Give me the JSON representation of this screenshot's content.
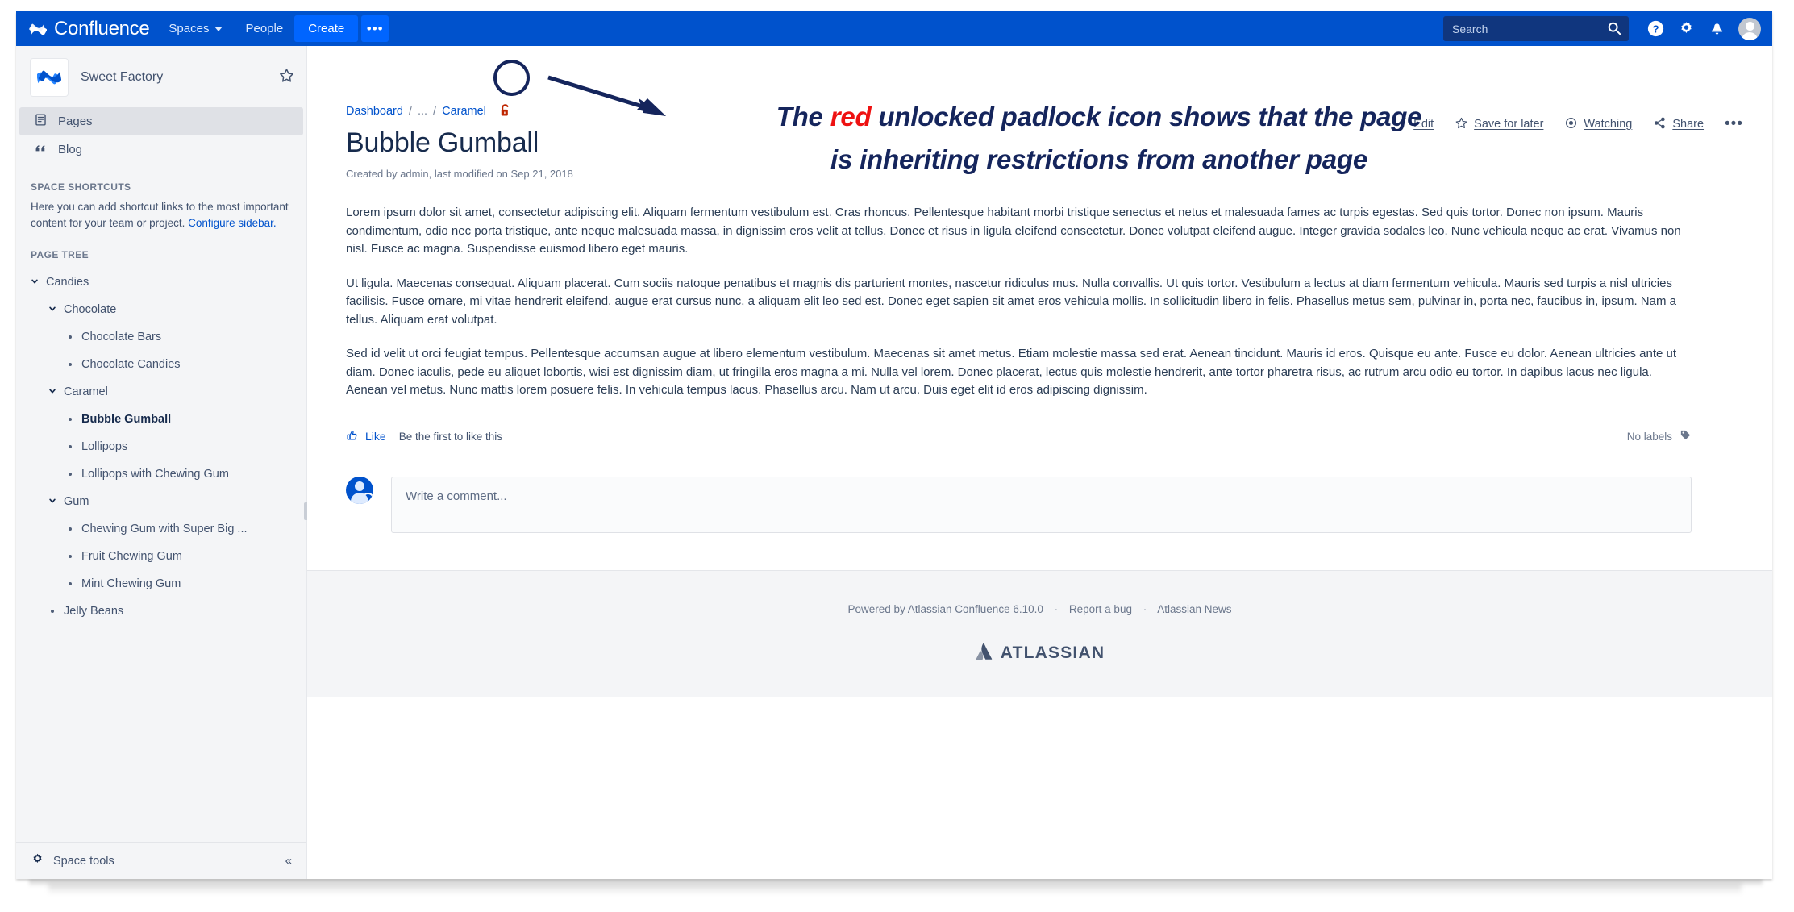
{
  "topnav": {
    "brand": "Confluence",
    "brand_logo_icon": "confluence-logo-icon",
    "items": [
      {
        "label": "Spaces",
        "icon": "chevron-down-icon"
      },
      {
        "label": "People",
        "icon": ""
      }
    ],
    "create_label": "Create",
    "more_label": "•••",
    "search": {
      "placeholder": "Search",
      "value": "",
      "icon": "search-icon"
    },
    "icons": [
      "help-icon",
      "gear-icon",
      "notification-bell-icon",
      "user-avatar-icon"
    ]
  },
  "sidebar": {
    "space_name": "Sweet Factory",
    "space_logo_icon": "confluence-space-logo-icon",
    "star_icon": "star-outline-icon",
    "links": [
      {
        "label": "Pages",
        "icon": "pages-icon",
        "active": true
      },
      {
        "label": "Blog",
        "icon": "quote-icon",
        "active": false
      }
    ],
    "shortcuts_heading": "SPACE SHORTCUTS",
    "shortcuts_description": "Here you can add shortcut links to the most important content for your team or project.",
    "configure_link": "Configure sidebar.",
    "pagetree_heading": "PAGE TREE",
    "tree": [
      {
        "label": "Candies",
        "level": 0,
        "marker": "chevron",
        "selected": false
      },
      {
        "label": "Chocolate",
        "level": 1,
        "marker": "chevron",
        "selected": false
      },
      {
        "label": "Chocolate Bars",
        "level": 2,
        "marker": "dot",
        "selected": false
      },
      {
        "label": "Chocolate Candies",
        "level": 2,
        "marker": "dot",
        "selected": false
      },
      {
        "label": "Caramel",
        "level": 1,
        "marker": "chevron",
        "selected": false
      },
      {
        "label": "Bubble Gumball",
        "level": 2,
        "marker": "dot",
        "selected": true
      },
      {
        "label": "Lollipops",
        "level": 2,
        "marker": "dot",
        "selected": false
      },
      {
        "label": "Lollipops with Chewing Gum",
        "level": 2,
        "marker": "dot",
        "selected": false
      },
      {
        "label": "Gum",
        "level": 1,
        "marker": "chevron",
        "selected": false
      },
      {
        "label": "Chewing Gum with Super Big ...",
        "level": 2,
        "marker": "dot",
        "selected": false
      },
      {
        "label": "Fruit Chewing Gum",
        "level": 2,
        "marker": "dot",
        "selected": false
      },
      {
        "label": "Mint Chewing Gum",
        "level": 2,
        "marker": "dot",
        "selected": false
      },
      {
        "label": "Jelly Beans",
        "level": 1,
        "marker": "dot",
        "selected": false
      }
    ],
    "space_tools_label": "Space tools",
    "space_tools_icon": "gear-icon",
    "collapse_icon": "double-chevron-left-icon"
  },
  "page": {
    "breadcrumb": [
      {
        "label": "Dashboard",
        "link": true
      },
      {
        "label": "...",
        "link": false
      },
      {
        "label": "Caramel",
        "link": true
      }
    ],
    "breadcrumb_separator": "/",
    "restriction_icon": "unlocked-padlock-red-icon",
    "title": "Bubble Gumball",
    "meta": "Created by admin, last modified on Sep 21, 2018",
    "actions": [
      {
        "label": "Edit",
        "icon": "pencil-icon"
      },
      {
        "label": "Save for later",
        "icon": "star-outline-icon"
      },
      {
        "label": "Watching",
        "icon": "eye-icon"
      },
      {
        "label": "Share",
        "icon": "share-icon"
      }
    ],
    "actions_more": "•••",
    "paragraphs": [
      "Lorem ipsum dolor sit amet, consectetur adipiscing elit. Aliquam fermentum vestibulum est. Cras rhoncus. Pellentesque habitant morbi tristique senectus et netus et malesuada fames ac turpis egestas. Sed quis tortor. Donec non ipsum. Mauris condimentum, odio nec porta tristique, ante neque malesuada massa, in dignissim eros velit at tellus. Donec et risus in ligula eleifend consectetur. Donec volutpat eleifend augue. Integer gravida sodales leo. Nunc vehicula neque ac erat. Vivamus non nisl. Fusce ac magna. Suspendisse euismod libero eget mauris.",
      "Ut ligula. Maecenas consequat. Aliquam placerat. Cum sociis natoque penatibus et magnis dis parturient montes, nascetur ridiculus mus. Nulla convallis. Ut quis tortor. Vestibulum a lectus at diam fermentum vehicula. Mauris sed turpis a nisl ultricies facilisis. Fusce ornare, mi vitae hendrerit eleifend, augue erat cursus nunc, a aliquam elit leo sed est. Donec eget sapien sit amet eros vehicula mollis. In sollicitudin libero in felis. Phasellus metus sem, pulvinar in, porta nec, faucibus in, ipsum. Nam a tellus. Aliquam erat volutpat.",
      "Sed id velit ut orci feugiat tempus. Pellentesque accumsan augue at libero elementum vestibulum. Maecenas sit amet metus. Etiam molestie massa sed erat. Aenean tincidunt. Mauris id eros. Quisque eu ante. Fusce eu dolor. Aenean ultricies ante ut diam. Donec iaculis, pede eu aliquet lobortis, wisi est dignissim diam, ut fringilla eros magna a mi. Nulla vel lorem. Donec placerat, lectus quis molestie hendrerit, ante tortor pharetra risus, ac rutrum arcu odio eu tortor. In dapibus lacus nec ligula. Aenean vel metus. Nunc mattis lorem posuere felis. In vehicula tempus lacus. Phasellus arcu. Nam ut arcu. Duis eget elit id eros adipiscing dignissim."
    ],
    "like_label": "Like",
    "like_icon": "thumbs-up-icon",
    "like_hint": "Be the first to like this",
    "labels_text": "No labels",
    "labels_icon": "label-tag-icon",
    "comment_placeholder": "Write a comment...",
    "comment_avatar_icon": "user-avatar-edit-icon"
  },
  "footer": {
    "powered_by": "Powered by Atlassian Confluence 6.10.0",
    "report_bug": "Report a bug",
    "news": "Atlassian News",
    "separator": "·",
    "logo_text": "ATLASSIAN",
    "logo_icon": "atlassian-logo-icon"
  },
  "annotation": {
    "line1_a": "The ",
    "line1_red": "red",
    "line1_b": " unlocked padlock icon shows that the page",
    "line2": "is inheriting restrictions from another page",
    "highlight_color": "#ee1111",
    "text_color": "#15255c",
    "circle_target": "restriction-padlock-icon",
    "arrow_icon": "annotation-arrow-icon"
  },
  "colors": {
    "brand_blue": "#0052CC",
    "nav_blue": "#0065FF",
    "sidebar_bg": "#F4F5F7",
    "text_dark": "#172B4D",
    "text_muted": "#6B778C",
    "padlock_red": "#BF2600"
  }
}
